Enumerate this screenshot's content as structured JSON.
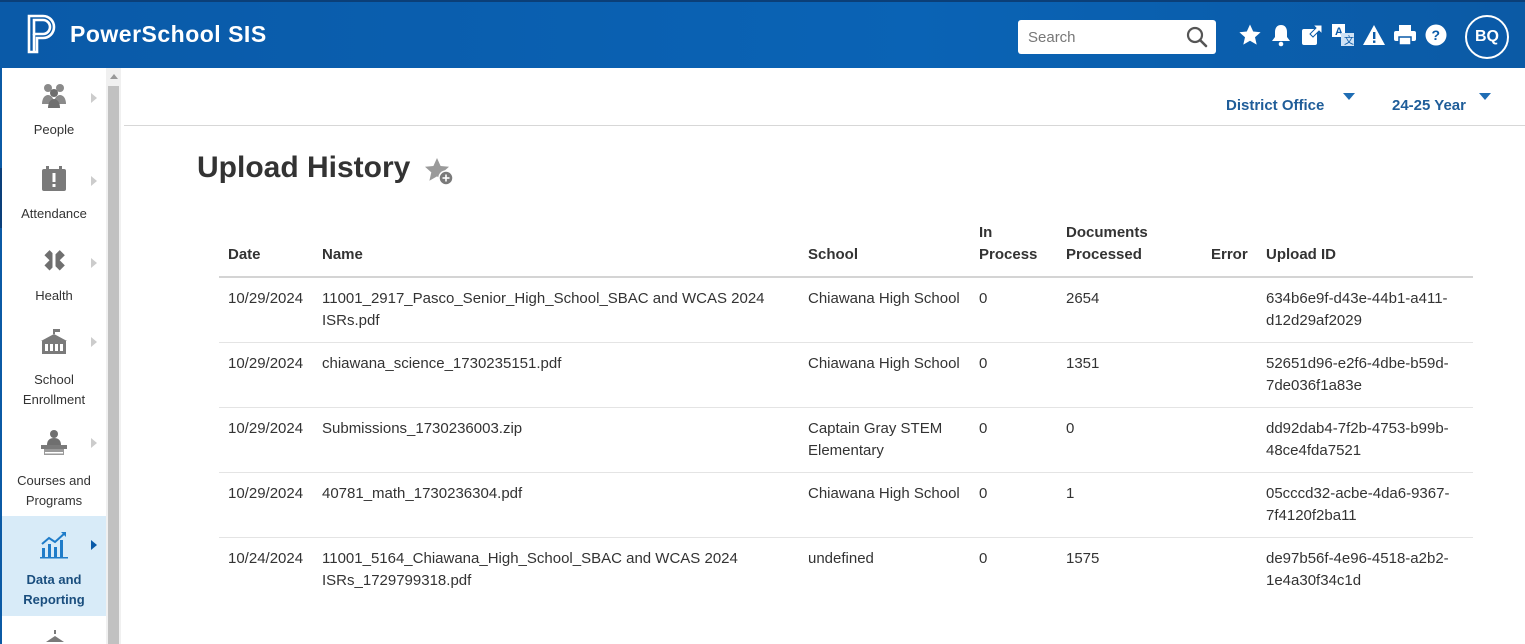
{
  "header": {
    "app_name": "PowerSchool SIS",
    "search_placeholder": "Search",
    "avatar_initials": "BQ",
    "icons": [
      "star-icon",
      "bell-icon",
      "external-link-icon",
      "translate-icon",
      "alert-icon",
      "printer-icon",
      "help-icon"
    ]
  },
  "sidebar": {
    "items": [
      {
        "label": "People",
        "icon": "people-icon"
      },
      {
        "label": "Attendance",
        "icon": "attendance-icon"
      },
      {
        "label": "Health",
        "icon": "health-icon"
      },
      {
        "label": "School Enrollment",
        "icon": "school-icon"
      },
      {
        "label": "Courses and Programs",
        "icon": "courses-icon"
      },
      {
        "label": "Data and Reporting",
        "icon": "chart-icon",
        "active": true
      }
    ]
  },
  "context": {
    "school": "District Office",
    "term": "24-25 Year"
  },
  "page": {
    "title": "Upload History"
  },
  "table": {
    "headers": {
      "date": "Date",
      "name": "Name",
      "school": "School",
      "in_process": "In Process",
      "documents_processed": "Documents Processed",
      "error": "Error",
      "upload_id": "Upload ID"
    },
    "rows": [
      {
        "date": "10/29/2024",
        "name": "11001_2917_Pasco_Senior_High_School_SBAC and WCAS 2024 ISRs.pdf",
        "school": "Chiawana High School",
        "in_process": "0",
        "documents_processed": "2654",
        "error": "",
        "upload_id": "634b6e9f-d43e-44b1-a411-d12d29af2029"
      },
      {
        "date": "10/29/2024",
        "name": "chiawana_science_1730235151.pdf",
        "school": "Chiawana High School",
        "in_process": "0",
        "documents_processed": "1351",
        "error": "",
        "upload_id": "52651d96-e2f6-4dbe-b59d-7de036f1a83e"
      },
      {
        "date": "10/29/2024",
        "name": "Submissions_1730236003.zip",
        "school": "Captain Gray STEM Elementary",
        "in_process": "0",
        "documents_processed": "0",
        "error": "",
        "upload_id": "dd92dab4-7f2b-4753-b99b-48ce4fda7521"
      },
      {
        "date": "10/29/2024",
        "name": "40781_math_1730236304.pdf",
        "school": "Chiawana High School",
        "in_process": "0",
        "documents_processed": "1",
        "error": "",
        "upload_id": "05cccd32-acbe-4da6-9367-7f4120f2ba11"
      },
      {
        "date": "10/24/2024",
        "name": "11001_5164_Chiawana_High_School_SBAC and WCAS 2024 ISRs_1729799318.pdf",
        "school": "undefined",
        "in_process": "0",
        "documents_processed": "1575",
        "error": "",
        "upload_id": "de97b56f-4e96-4518-a2b2-1e4a30f34c1d"
      }
    ]
  },
  "colors": {
    "header_blue": "#0a5aa8",
    "link_blue": "#1f5d99",
    "active_nav_bg": "#d8ebf8"
  }
}
